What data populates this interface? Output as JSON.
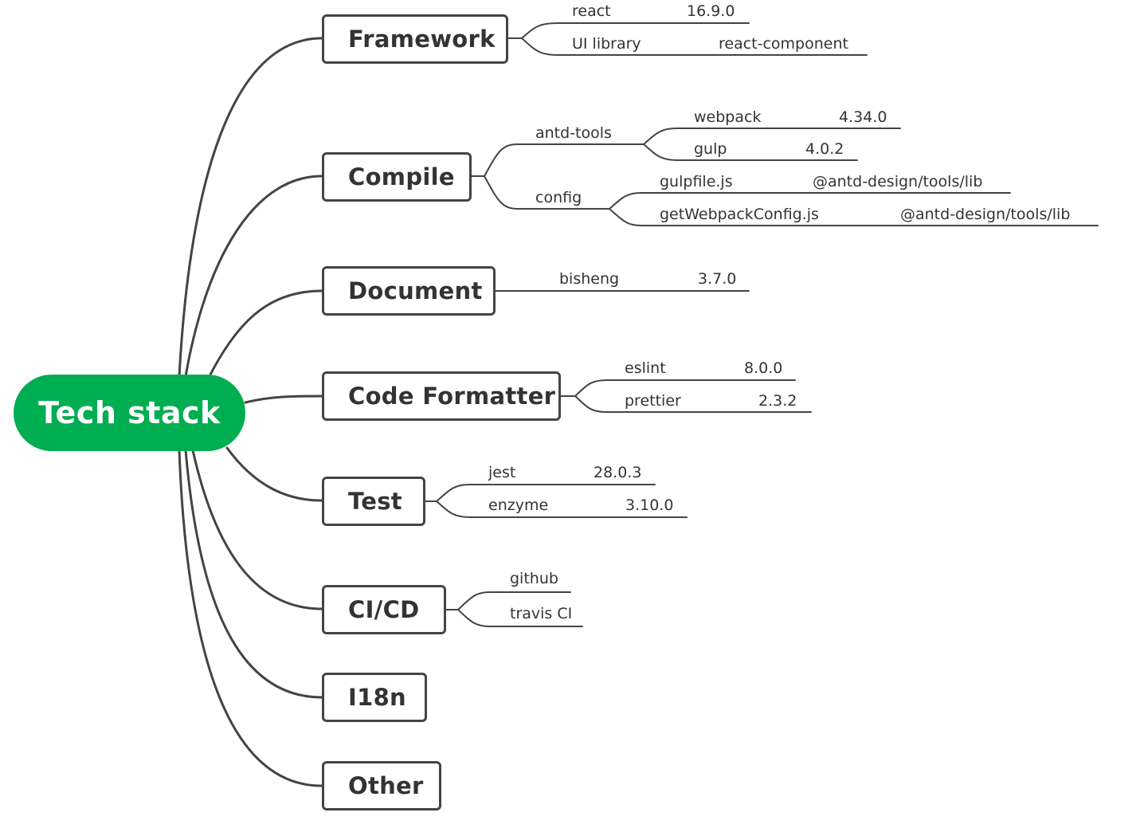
{
  "root": {
    "label": "Tech stack",
    "color": "#00ad50"
  },
  "topics": [
    {
      "label": "Framework",
      "children": [
        {
          "name": "react",
          "value": "16.9.0"
        },
        {
          "name": "UI library",
          "value": "react-component"
        }
      ]
    },
    {
      "label": "Compile",
      "children": [
        {
          "name": "antd-tools",
          "children": [
            {
              "name": "webpack",
              "value": "4.34.0"
            },
            {
              "name": "gulp",
              "value": "4.0.2"
            }
          ]
        },
        {
          "name": "config",
          "children": [
            {
              "name": "gulpfile.js",
              "value": "@antd-design/tools/lib"
            },
            {
              "name": "getWebpackConfig.js",
              "value": "@antd-design/tools/lib"
            }
          ]
        }
      ]
    },
    {
      "label": "Document",
      "children": [
        {
          "name": "bisheng",
          "value": "3.7.0"
        }
      ]
    },
    {
      "label": "Code Formatter",
      "children": [
        {
          "name": "eslint",
          "value": "8.0.0"
        },
        {
          "name": "prettier",
          "value": "2.3.2"
        }
      ]
    },
    {
      "label": "Test",
      "children": [
        {
          "name": "jest",
          "value": "28.0.3"
        },
        {
          "name": "enzyme",
          "value": "3.10.0"
        }
      ]
    },
    {
      "label": "CI/CD",
      "children": [
        {
          "name": "github"
        },
        {
          "name": "travis CI"
        }
      ]
    },
    {
      "label": "I18n",
      "children": []
    },
    {
      "label": "Other",
      "children": []
    }
  ]
}
